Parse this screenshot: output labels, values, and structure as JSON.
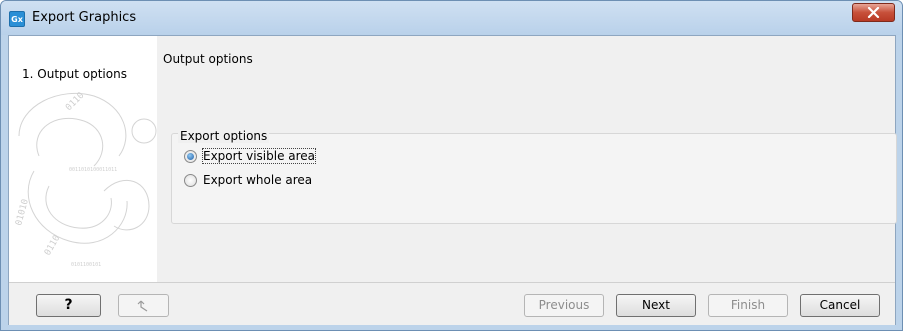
{
  "window": {
    "title": "Export Graphics",
    "app_icon_text": "Gx",
    "close_icon": "close-icon"
  },
  "sidebar": {
    "steps": [
      {
        "number": "1.",
        "label": "Output options"
      }
    ],
    "step1_text": "1.  Output options",
    "decoration_icon": "binary-swirl-icon"
  },
  "main": {
    "title": "Output options",
    "group": {
      "title": "Export options",
      "options": [
        {
          "label": "Export visible area",
          "checked": true
        },
        {
          "label": "Export whole area",
          "checked": false
        }
      ]
    }
  },
  "footer": {
    "help_label": "?",
    "restore_icon": "restore-defaults-icon",
    "previous_label": "Previous",
    "next_label": "Next",
    "finish_label": "Finish",
    "cancel_label": "Cancel"
  },
  "colors": {
    "titlebar": "#c4d9ef",
    "close_button": "#c7503a",
    "radio_selected": "#1f5fa6"
  }
}
